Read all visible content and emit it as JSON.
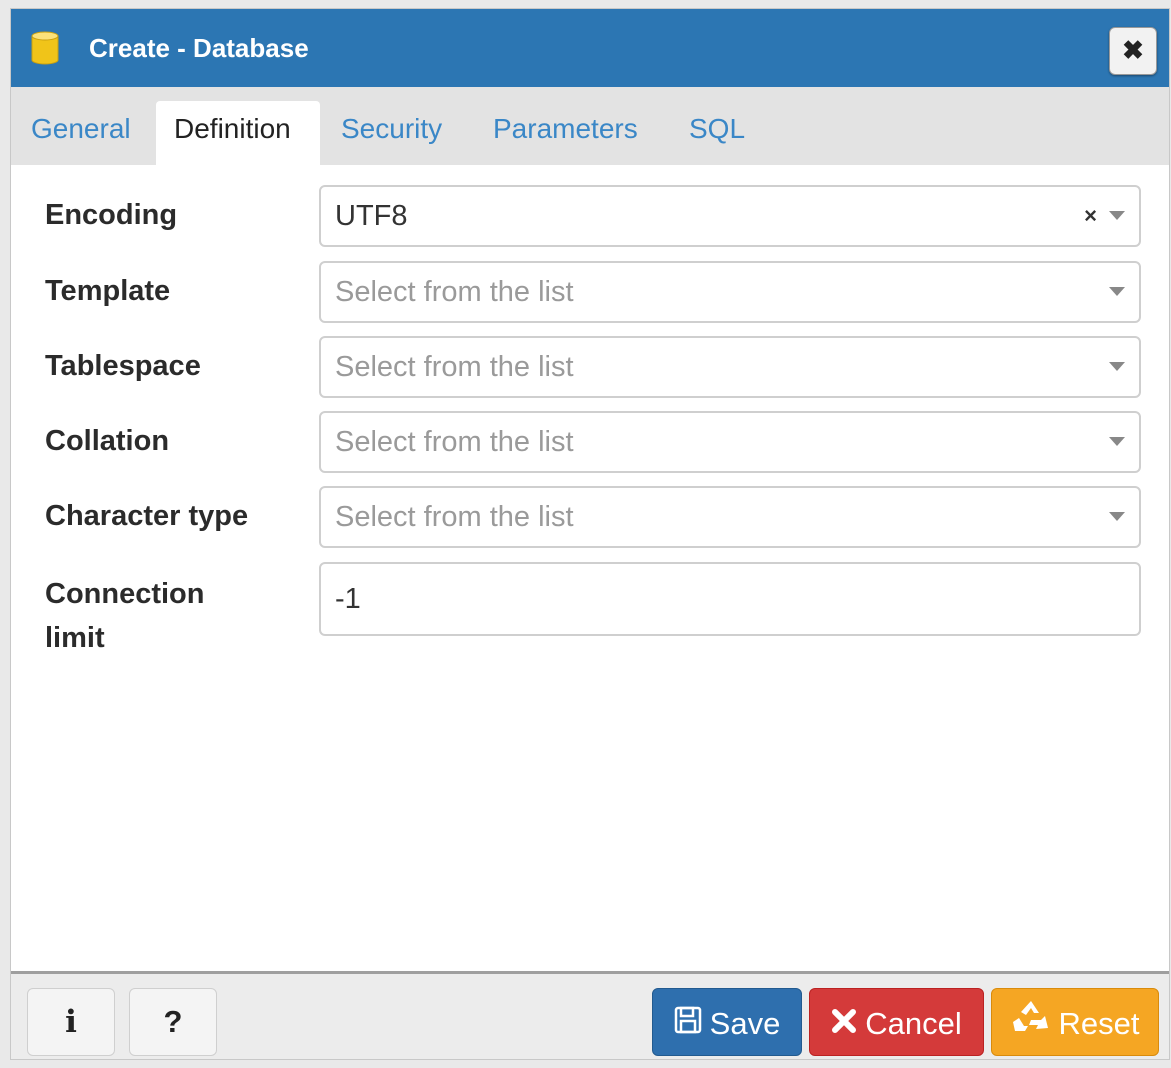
{
  "dialog": {
    "title": "Create - Database",
    "close_glyph": "✖",
    "title_icon": "database-icon"
  },
  "tabs": [
    {
      "label": "General",
      "active": false
    },
    {
      "label": "Definition",
      "active": true
    },
    {
      "label": "Security",
      "active": false
    },
    {
      "label": "Parameters",
      "active": false
    },
    {
      "label": "SQL",
      "active": false
    }
  ],
  "form": {
    "encoding": {
      "label": "Encoding",
      "value": "UTF8",
      "clear_glyph": "×"
    },
    "template": {
      "label": "Template",
      "placeholder": "Select from the list"
    },
    "tablespace": {
      "label": "Tablespace",
      "placeholder": "Select from the list"
    },
    "collation": {
      "label": "Collation",
      "placeholder": "Select from the list"
    },
    "character_type": {
      "label": "Character type",
      "placeholder": "Select from the list"
    },
    "connection_limit": {
      "label_line1": "Connection",
      "label_line2": "limit",
      "value": "-1"
    }
  },
  "footer": {
    "info_label": "i",
    "help_label": "?",
    "save_label": "Save",
    "cancel_label": "Cancel",
    "reset_label": "Reset"
  },
  "colors": {
    "title_bar": "#2c76b3",
    "save": "#2e6fae",
    "cancel": "#d43a3a",
    "reset": "#f5a623",
    "tab_link": "#3a87c7"
  }
}
